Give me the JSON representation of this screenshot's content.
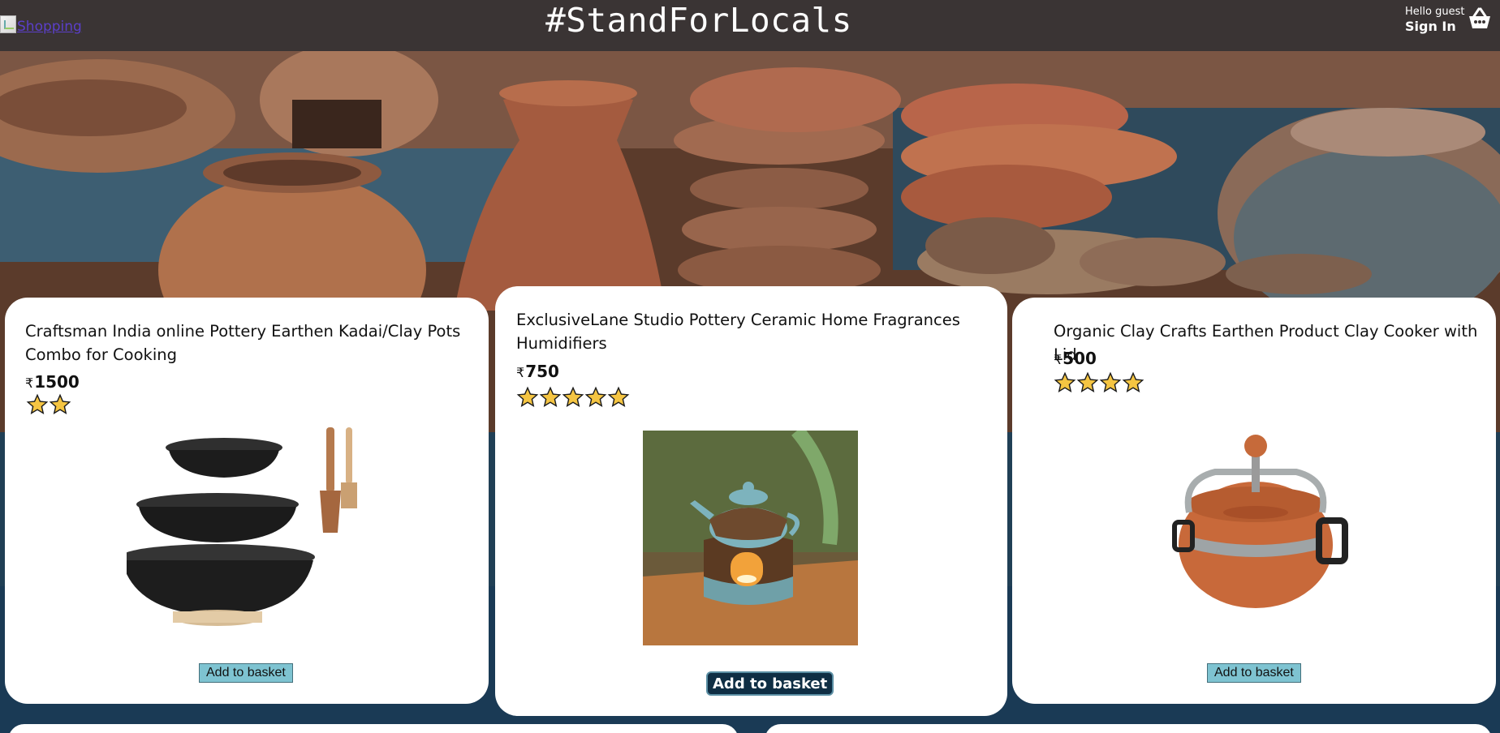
{
  "header": {
    "logo_alt": "Shopping",
    "brand": "#StandForLocals",
    "greeting": "Hello guest",
    "sign_in": "Sign In"
  },
  "currency_symbol": "₹",
  "products": [
    {
      "title": "Craftsman India online Pottery Earthen Kadai/Clay Pots Combo for Cooking",
      "price": "1500",
      "rating": 2,
      "button": "Add to basket"
    },
    {
      "title": "ExclusiveLane Studio Pottery Ceramic Home Fragrances Humidifiers",
      "price": "750",
      "rating": 5,
      "button": "Add to basket"
    },
    {
      "title": "Organic Clay Crafts Earthen Product Clay Cooker with Lid",
      "price": "500",
      "rating": 4,
      "button": "Add to basket"
    }
  ],
  "colors": {
    "header_bg": "#3a3434",
    "star_fill": "#f5c542",
    "button_bg": "#7ec3d1",
    "button_hover_bg": "#0f2e44"
  }
}
